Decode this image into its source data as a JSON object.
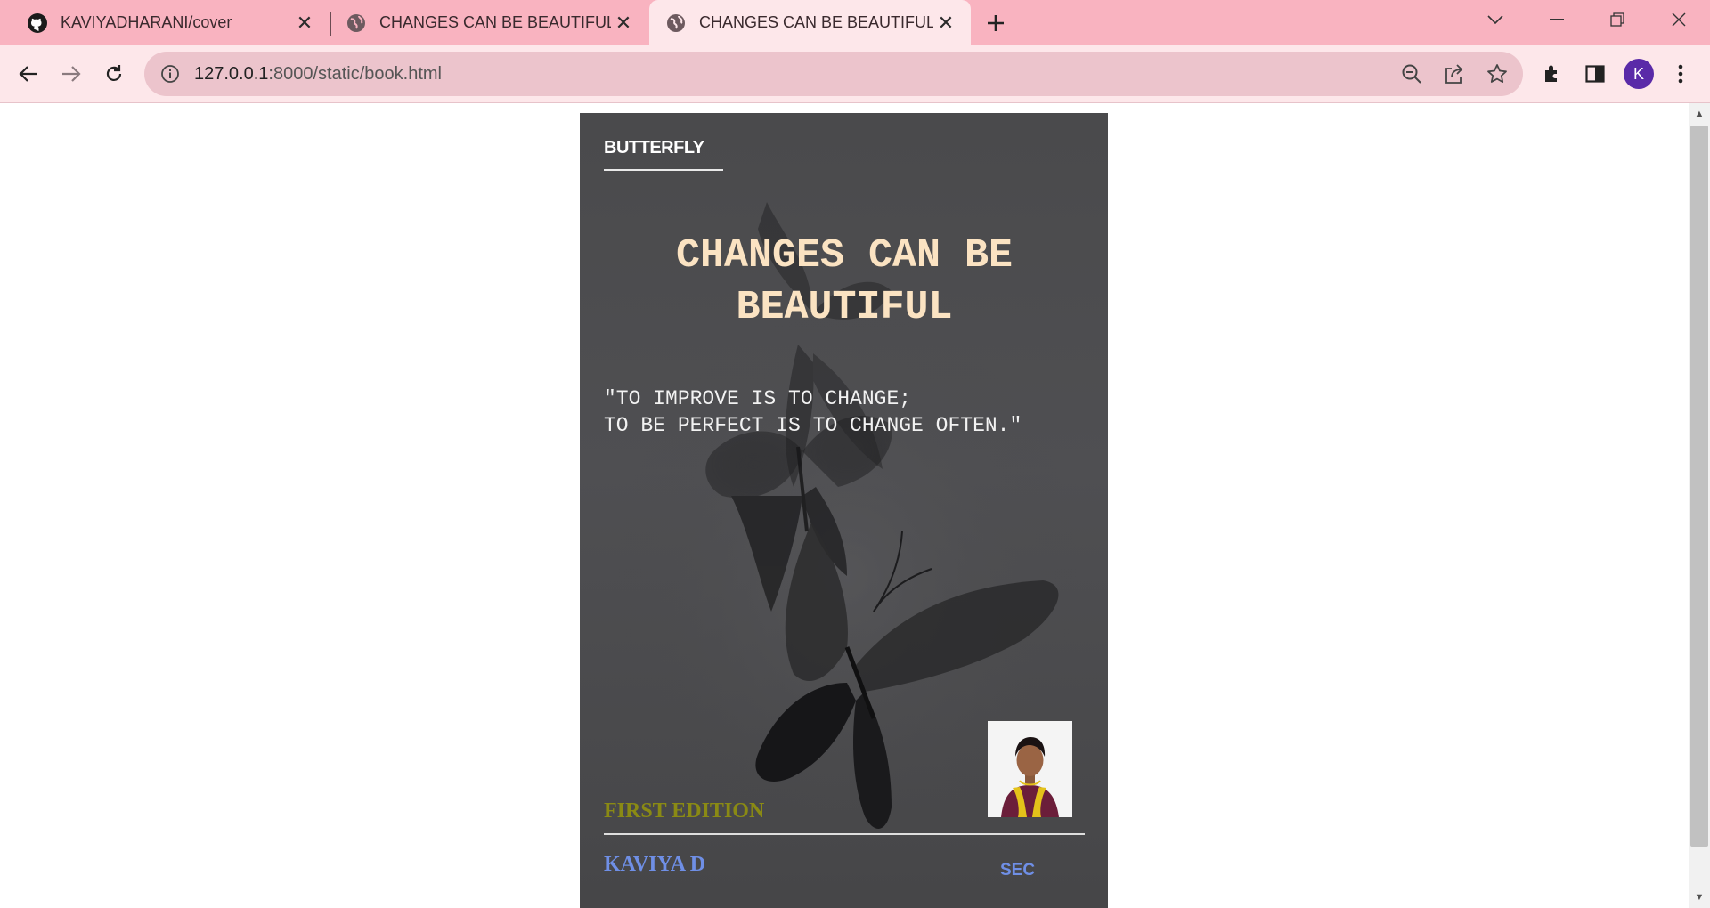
{
  "browser": {
    "tabs": [
      {
        "title": "KAVIYADHARANI/cover",
        "icon": "github-icon",
        "active": false
      },
      {
        "title": "CHANGES CAN BE BEAUTIFUL",
        "icon": "globe-icon",
        "active": false
      },
      {
        "title": "CHANGES CAN BE BEAUTIFUL",
        "icon": "globe-icon",
        "active": true
      }
    ],
    "address": {
      "host": "127.0.0.1",
      "path": ":8000/static/book.html"
    },
    "profile_initial": "K",
    "colors": {
      "tabstrip": "#f9b3c0",
      "toolbar": "#fde7ea",
      "omnibox": "#ecc4cc",
      "avatar": "#5a2aa8"
    }
  },
  "cover": {
    "publisher": "BUTTERFLY",
    "title": "CHANGES CAN BE BEAUTIFUL",
    "quote_line1": "\"TO IMPROVE IS TO CHANGE;",
    "quote_line2": "TO BE PERFECT IS TO CHANGE OFTEN.\"",
    "edition": "FIRST EDITION",
    "author": "KAVIYA D",
    "college": "SEC",
    "colors": {
      "background": "#4c4c4e",
      "title": "#fbe3c2",
      "edition": "#8a8a14",
      "author": "#6f8fe6"
    }
  }
}
